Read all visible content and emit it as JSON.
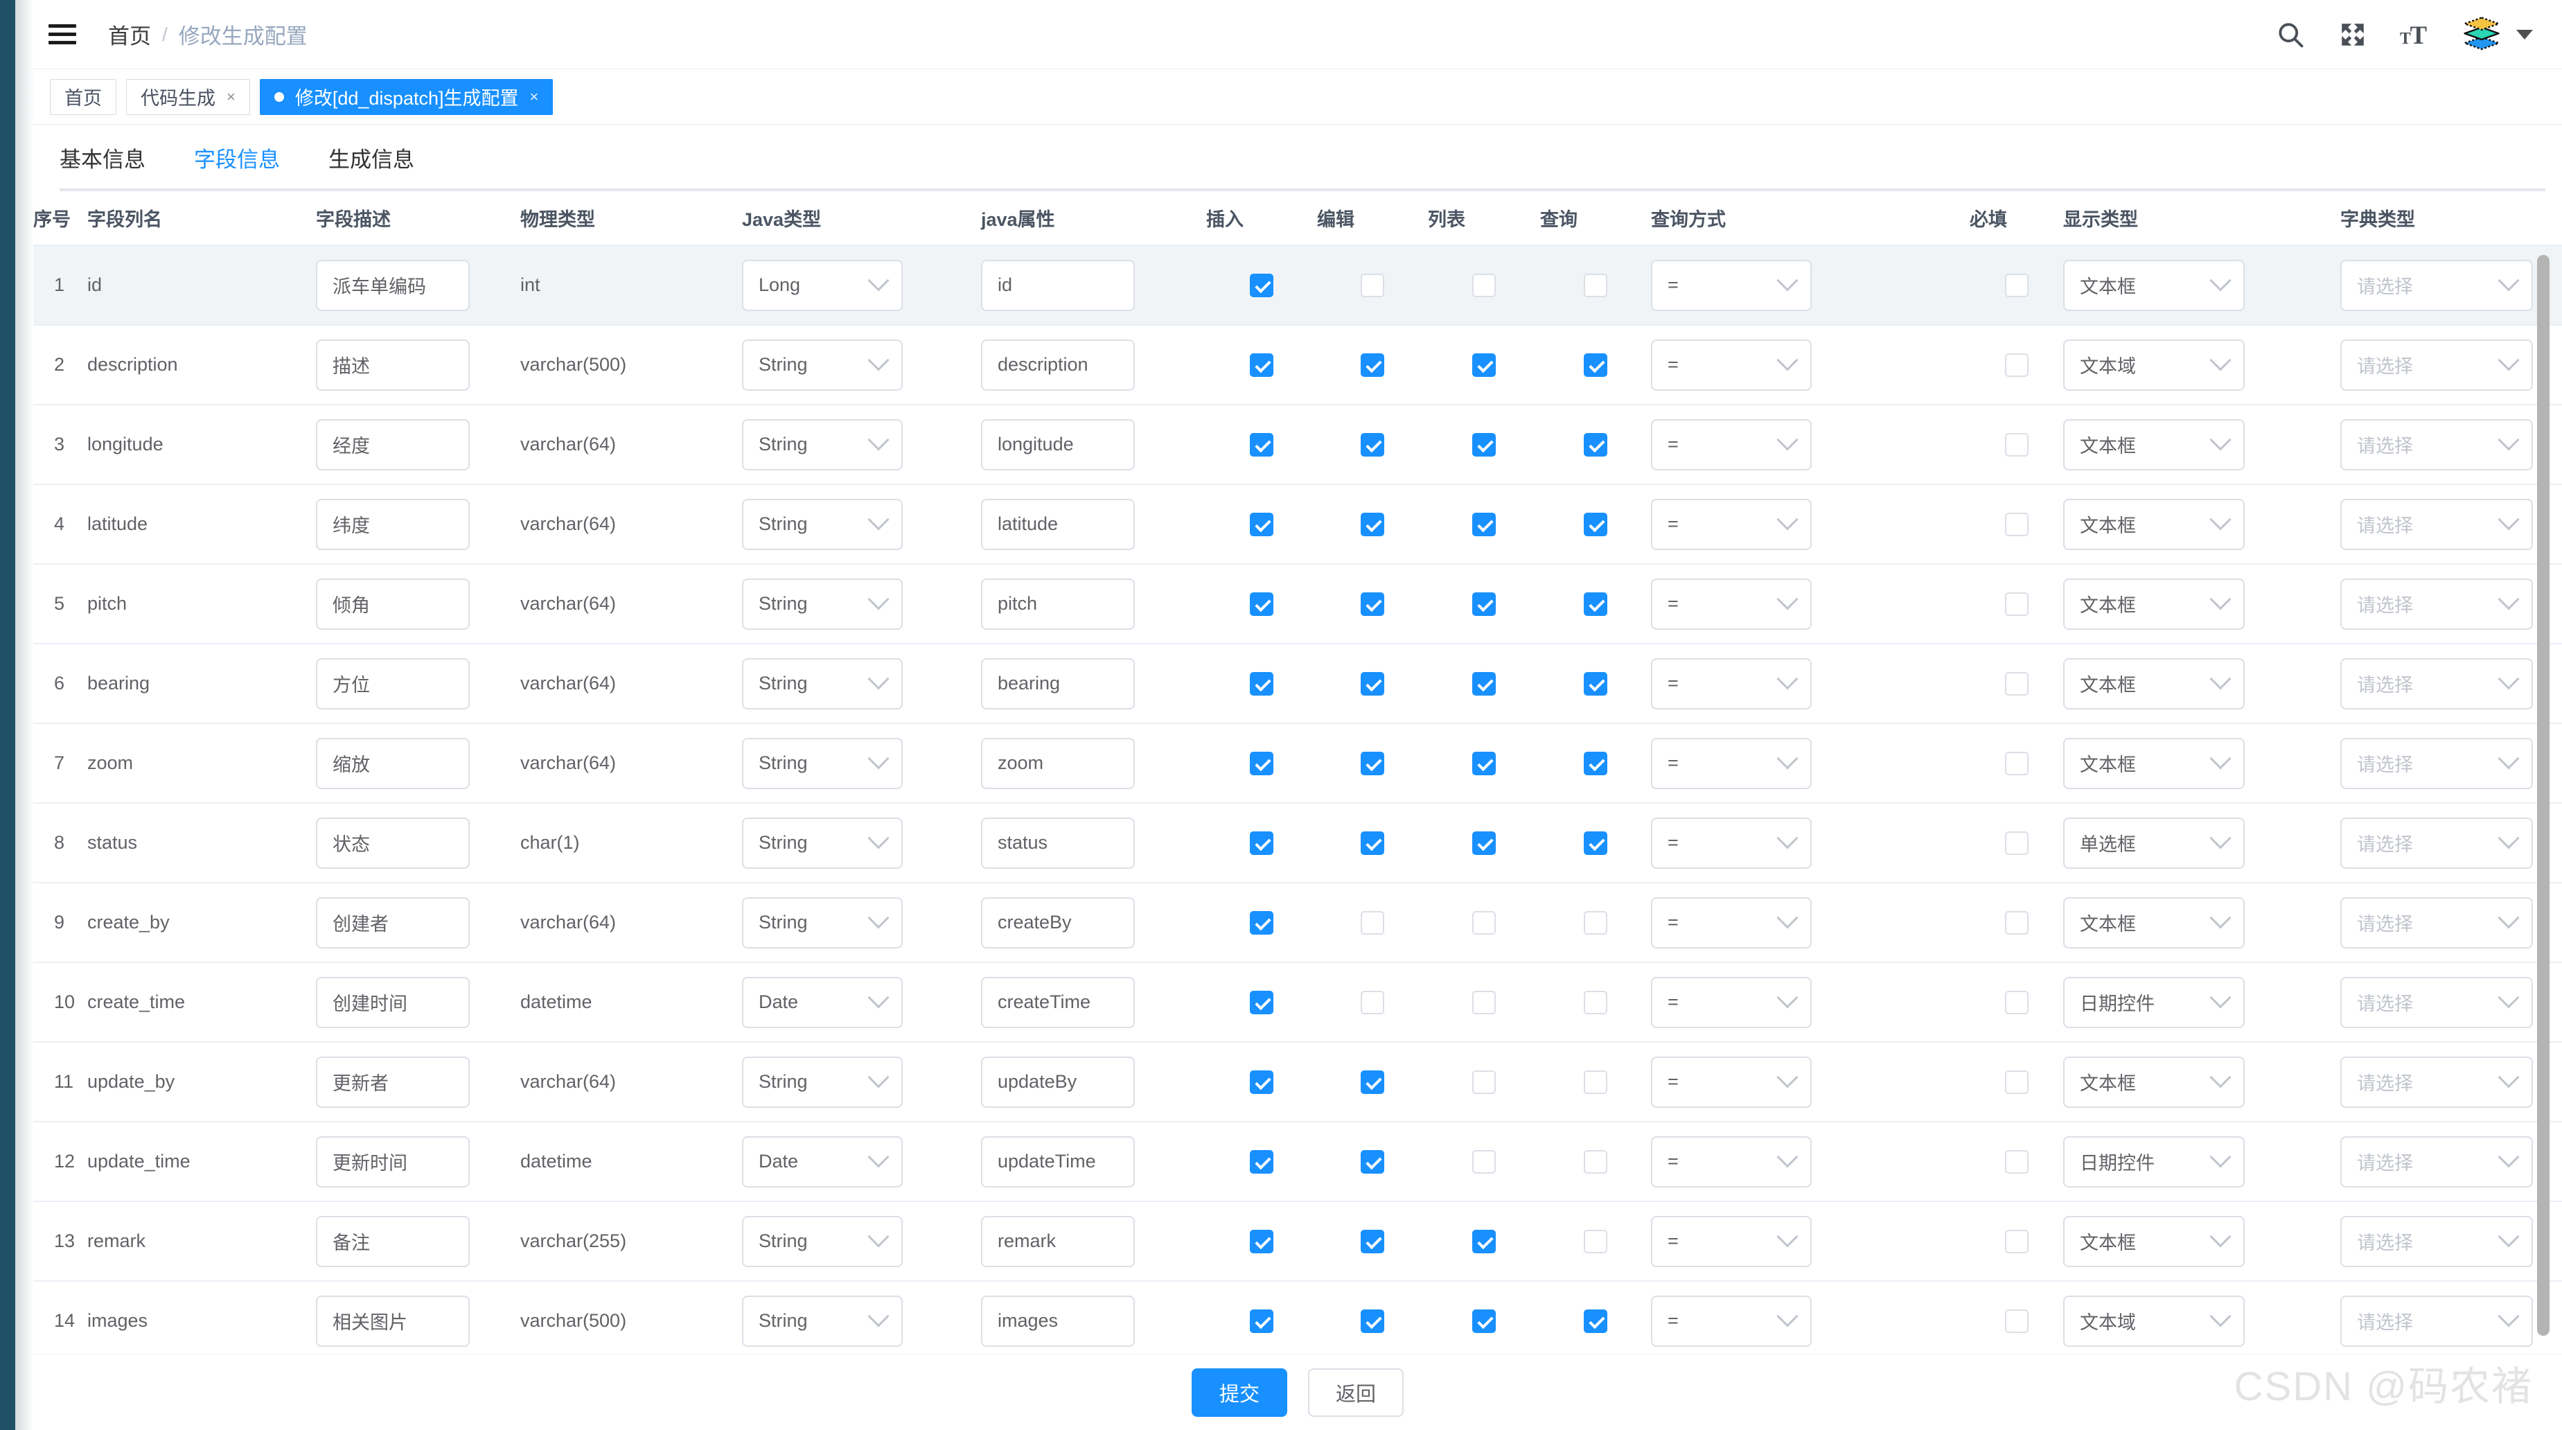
{
  "navbar": {
    "breadcrumb": {
      "home": "首页",
      "separator": "/",
      "current": "修改生成配置"
    },
    "icons": {
      "menu": "hamburger-menu-icon",
      "search": "search-icon",
      "fullscreen": "fullscreen-icon",
      "font_size": "font-size-icon",
      "avatar": "layers-avatar-icon"
    }
  },
  "tagbar": {
    "tags": [
      {
        "label": "首页",
        "closable": false,
        "active": false
      },
      {
        "label": "代码生成",
        "closable": true,
        "active": false
      },
      {
        "label": "修改[dd_dispatch]生成配置",
        "closable": true,
        "active": true
      }
    ],
    "close_glyph": "×"
  },
  "tabs": [
    {
      "label": "基本信息",
      "active": false
    },
    {
      "label": "字段信息",
      "active": true
    },
    {
      "label": "生成信息",
      "active": false
    }
  ],
  "table": {
    "headers": {
      "seq": "序号",
      "column_name": "字段列名",
      "column_desc": "字段描述",
      "physical_type": "物理类型",
      "java_type": "Java类型",
      "java_attr": "java属性",
      "insert": "插入",
      "edit": "编辑",
      "list": "列表",
      "query": "查询",
      "query_type": "查询方式",
      "required": "必填",
      "display_type": "显示类型",
      "dict_type": "字典类型"
    },
    "dict_placeholder": "请选择",
    "rows": [
      {
        "seq": "1",
        "name": "id",
        "desc": "派车单编码",
        "phys": "int",
        "jtype": "Long",
        "jattr": "id",
        "insert": true,
        "edit": false,
        "list": false,
        "query": false,
        "qtype": "=",
        "required": false,
        "disp": "文本框",
        "dict": "请选择",
        "highlight": true
      },
      {
        "seq": "2",
        "name": "description",
        "desc": "描述",
        "phys": "varchar(500)",
        "jtype": "String",
        "jattr": "description",
        "insert": true,
        "edit": true,
        "list": true,
        "query": true,
        "qtype": "=",
        "required": false,
        "disp": "文本域",
        "dict": "请选择",
        "highlight": false
      },
      {
        "seq": "3",
        "name": "longitude",
        "desc": "经度",
        "phys": "varchar(64)",
        "jtype": "String",
        "jattr": "longitude",
        "insert": true,
        "edit": true,
        "list": true,
        "query": true,
        "qtype": "=",
        "required": false,
        "disp": "文本框",
        "dict": "请选择",
        "highlight": false
      },
      {
        "seq": "4",
        "name": "latitude",
        "desc": "纬度",
        "phys": "varchar(64)",
        "jtype": "String",
        "jattr": "latitude",
        "insert": true,
        "edit": true,
        "list": true,
        "query": true,
        "qtype": "=",
        "required": false,
        "disp": "文本框",
        "dict": "请选择",
        "highlight": false
      },
      {
        "seq": "5",
        "name": "pitch",
        "desc": "倾角",
        "phys": "varchar(64)",
        "jtype": "String",
        "jattr": "pitch",
        "insert": true,
        "edit": true,
        "list": true,
        "query": true,
        "qtype": "=",
        "required": false,
        "disp": "文本框",
        "dict": "请选择",
        "highlight": false
      },
      {
        "seq": "6",
        "name": "bearing",
        "desc": "方位",
        "phys": "varchar(64)",
        "jtype": "String",
        "jattr": "bearing",
        "insert": true,
        "edit": true,
        "list": true,
        "query": true,
        "qtype": "=",
        "required": false,
        "disp": "文本框",
        "dict": "请选择",
        "highlight": false
      },
      {
        "seq": "7",
        "name": "zoom",
        "desc": "缩放",
        "phys": "varchar(64)",
        "jtype": "String",
        "jattr": "zoom",
        "insert": true,
        "edit": true,
        "list": true,
        "query": true,
        "qtype": "=",
        "required": false,
        "disp": "文本框",
        "dict": "请选择",
        "highlight": false
      },
      {
        "seq": "8",
        "name": "status",
        "desc": "状态",
        "phys": "char(1)",
        "jtype": "String",
        "jattr": "status",
        "insert": true,
        "edit": true,
        "list": true,
        "query": true,
        "qtype": "=",
        "required": false,
        "disp": "单选框",
        "dict": "请选择",
        "highlight": false
      },
      {
        "seq": "9",
        "name": "create_by",
        "desc": "创建者",
        "phys": "varchar(64)",
        "jtype": "String",
        "jattr": "createBy",
        "insert": true,
        "edit": false,
        "list": false,
        "query": false,
        "qtype": "=",
        "required": false,
        "disp": "文本框",
        "dict": "请选择",
        "highlight": false
      },
      {
        "seq": "10",
        "name": "create_time",
        "desc": "创建时间",
        "phys": "datetime",
        "jtype": "Date",
        "jattr": "createTime",
        "insert": true,
        "edit": false,
        "list": false,
        "query": false,
        "qtype": "=",
        "required": false,
        "disp": "日期控件",
        "dict": "请选择",
        "highlight": false
      },
      {
        "seq": "11",
        "name": "update_by",
        "desc": "更新者",
        "phys": "varchar(64)",
        "jtype": "String",
        "jattr": "updateBy",
        "insert": true,
        "edit": true,
        "list": false,
        "query": false,
        "qtype": "=",
        "required": false,
        "disp": "文本框",
        "dict": "请选择",
        "highlight": false
      },
      {
        "seq": "12",
        "name": "update_time",
        "desc": "更新时间",
        "phys": "datetime",
        "jtype": "Date",
        "jattr": "updateTime",
        "insert": true,
        "edit": true,
        "list": false,
        "query": false,
        "qtype": "=",
        "required": false,
        "disp": "日期控件",
        "dict": "请选择",
        "highlight": false
      },
      {
        "seq": "13",
        "name": "remark",
        "desc": "备注",
        "phys": "varchar(255)",
        "jtype": "String",
        "jattr": "remark",
        "insert": true,
        "edit": true,
        "list": true,
        "query": false,
        "qtype": "=",
        "required": false,
        "disp": "文本框",
        "dict": "请选择",
        "highlight": false
      },
      {
        "seq": "14",
        "name": "images",
        "desc": "相关图片",
        "phys": "varchar(500)",
        "jtype": "String",
        "jattr": "images",
        "insert": true,
        "edit": true,
        "list": true,
        "query": true,
        "qtype": "=",
        "required": false,
        "disp": "文本域",
        "dict": "请选择",
        "highlight": false
      }
    ]
  },
  "footer": {
    "submit_label": "提交",
    "back_label": "返回"
  },
  "watermark": "CSDN @码农褚",
  "colors": {
    "accent": "#1890ff",
    "rail": "#1f5066",
    "row_highlight": "#f0f4f7",
    "border": "#dcdfe6",
    "placeholder": "#c0c4cc"
  }
}
